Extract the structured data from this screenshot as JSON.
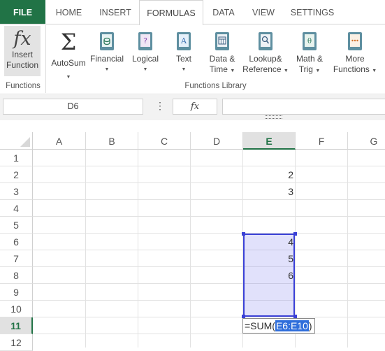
{
  "tabs": [
    "FILE",
    "HOME",
    "INSERT",
    "FORMULAS",
    "DATA",
    "VIEW",
    "SETTINGS"
  ],
  "active_tab": "FORMULAS",
  "ribbon": {
    "insert_function": {
      "icon": "fx",
      "label1": "Insert",
      "label2": "Function"
    },
    "autosum": {
      "icon": "Σ",
      "label": "AutoSum"
    },
    "financial": {
      "label": "Financial"
    },
    "logical": {
      "label": "Logical"
    },
    "text": {
      "label": "Text"
    },
    "datetime": {
      "label1": "Data &",
      "label2": "Time"
    },
    "lookup": {
      "label1": "Lookup&",
      "label2": "Reference"
    },
    "mathtrig": {
      "label1": "Math &",
      "label2": "Trig"
    },
    "more": {
      "label1": "More",
      "label2": "Functions"
    },
    "groups": {
      "functions": "Functions",
      "library": "Functions Library"
    }
  },
  "formula_bar": {
    "name_box": "D6",
    "fx": "fx",
    "formula": ""
  },
  "columns": [
    "A",
    "B",
    "C",
    "D",
    "E",
    "F",
    "G"
  ],
  "selected_column": "E",
  "rows": [
    "1",
    "2",
    "3",
    "4",
    "5",
    "6",
    "7",
    "8",
    "9",
    "10",
    "11",
    "12"
  ],
  "selected_row": "11",
  "cells": {
    "E2": "2",
    "E3": "3",
    "E6": "4",
    "E7": "5",
    "E8": "6"
  },
  "editor": {
    "prefix": "=SUM(",
    "ref": "E6:E10",
    "suffix": ")"
  },
  "colors": {
    "file_tab": "#217346",
    "selection": "#3a40d6",
    "selected_header_text": "#217346"
  }
}
